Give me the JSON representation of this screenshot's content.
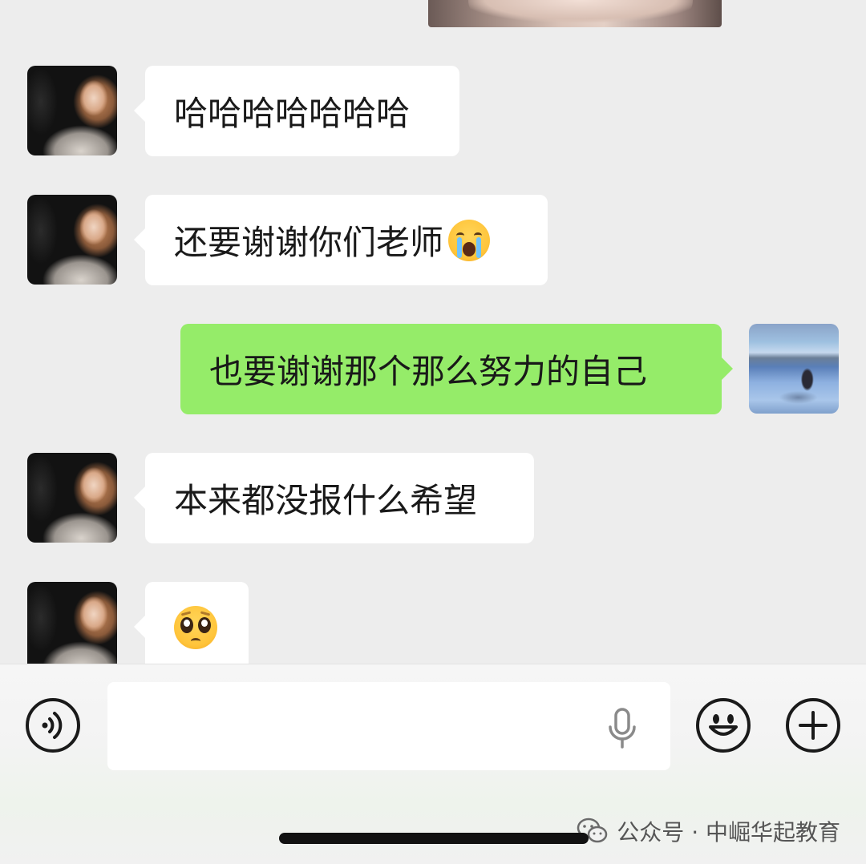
{
  "messages": [
    {
      "side": "left",
      "text": "哈哈哈哈哈哈哈",
      "emoji": ""
    },
    {
      "side": "left",
      "text": "还要谢谢你们老师",
      "emoji": "loudly-crying-face"
    },
    {
      "side": "right",
      "text": "也要谢谢那个那么努力的自己",
      "emoji": ""
    },
    {
      "side": "left",
      "text": "本来都没报什么希望",
      "emoji": ""
    },
    {
      "side": "left",
      "text": "",
      "emoji": "pleading-face"
    }
  ],
  "input": {
    "placeholder": "",
    "value": ""
  },
  "icons": {
    "voice": "voice-toggle-icon",
    "mic": "microphone-icon",
    "emoji": "smiley-face-icon",
    "plus": "plus-icon"
  },
  "watermark": {
    "text": "公众号 · 中崛华起教育"
  },
  "colors": {
    "background": "#ededed",
    "bubble_self": "#95ec69",
    "bubble_other": "#ffffff"
  }
}
